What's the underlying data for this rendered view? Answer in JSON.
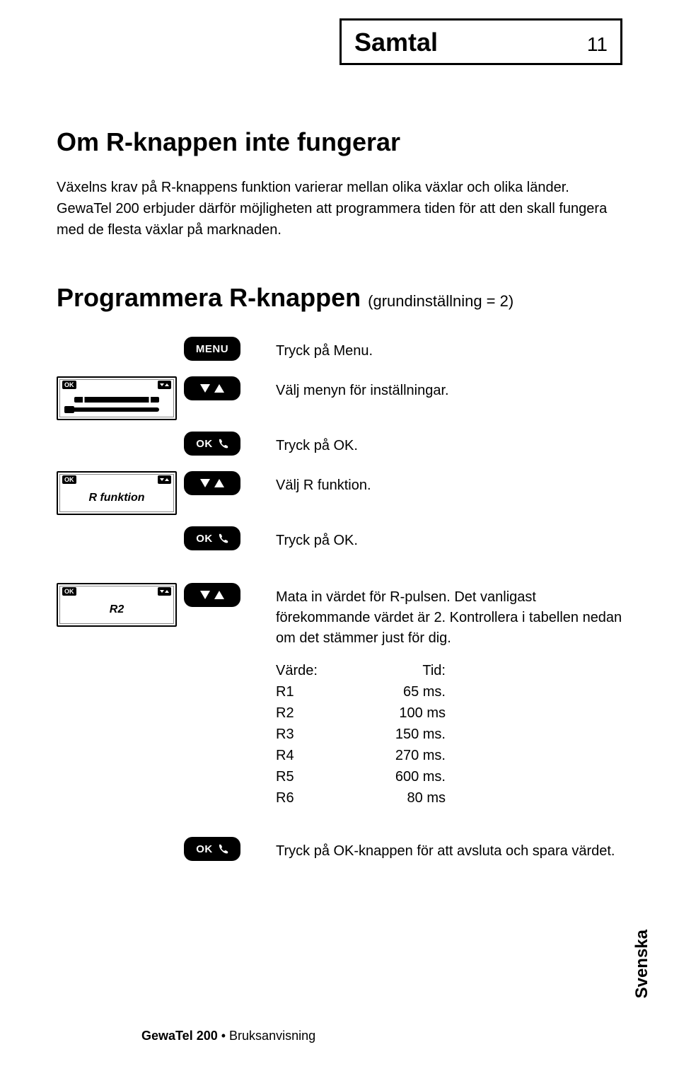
{
  "header": {
    "section": "Samtal",
    "page_number": "11"
  },
  "section1": {
    "title": "Om R-knappen inte fungerar",
    "body": "Växelns krav på R-knappens funktion varierar mellan olika växlar och olika länder. GewaTel 200 erbjuder därför möjligheten att programmera tiden för att den skall fungera med de flesta växlar på marknaden."
  },
  "section2": {
    "title": "Programmera R-knappen",
    "suffix": "(grundinställning = 2)"
  },
  "buttons": {
    "menu": "MENU",
    "ok": "OK"
  },
  "lcd": {
    "corner_ok": "OK",
    "r_funktion": "R funktion",
    "r2": "R2"
  },
  "steps": {
    "s1": "Tryck på Menu.",
    "s2": "Välj menyn för inställningar.",
    "s3": "Tryck på OK.",
    "s4": "Välj R funktion.",
    "s5": "Tryck på OK.",
    "s6": "Mata in värdet för R-pulsen. Det vanligast förekommande värdet är 2. Kontrollera i tabellen nedan om det stämmer just för dig.",
    "s7": "Tryck på OK-knappen för att avsluta och spara värdet."
  },
  "table": {
    "h1": "Värde:",
    "h2": "Tid:",
    "rows": [
      {
        "v": "R1",
        "t": "65 ms."
      },
      {
        "v": "R2",
        "t": "100 ms"
      },
      {
        "v": "R3",
        "t": "150 ms."
      },
      {
        "v": "R4",
        "t": "270 ms."
      },
      {
        "v": "R5",
        "t": "600 ms."
      },
      {
        "v": "R6",
        "t": "80 ms"
      }
    ]
  },
  "side_tab": "Svenska",
  "footer": {
    "product": "GewaTel 200",
    "sep": " • ",
    "doc": "Bruksanvisning"
  }
}
